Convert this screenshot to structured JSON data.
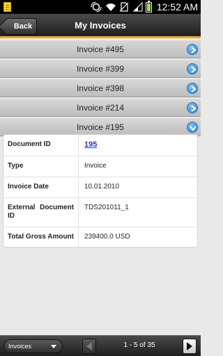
{
  "status_bar": {
    "time": "12:52 AM",
    "icons": [
      "notification-icon",
      "sync-icon",
      "wifi-icon",
      "no-sim-icon",
      "signal-icon",
      "battery-icon"
    ]
  },
  "header": {
    "back_label": "Back",
    "title": "My Invoices",
    "accent_color": "#f0a81e"
  },
  "invoices": [
    {
      "label": "Invoice #495",
      "state": "collapsed"
    },
    {
      "label": "Invoice #399",
      "state": "collapsed"
    },
    {
      "label": "Invoice #398",
      "state": "collapsed"
    },
    {
      "label": "Invoice #214",
      "state": "collapsed"
    },
    {
      "label": "Invoice #195",
      "state": "expanded"
    }
  ],
  "details": {
    "document_id": {
      "label": "Document ID",
      "value": "195"
    },
    "type": {
      "label": "Type",
      "value": "Invoice"
    },
    "invoice_date": {
      "label": "Invoice Date",
      "value": "10.01.2010"
    },
    "external_document_id": {
      "label": "External Document ID",
      "value": "TDS201011_1"
    },
    "total_gross_amount": {
      "label": "Total Gross Amount",
      "value": "239400.0 USD"
    }
  },
  "footer": {
    "select_value": "Invoices",
    "page_text": "1 - 5 of 35"
  }
}
